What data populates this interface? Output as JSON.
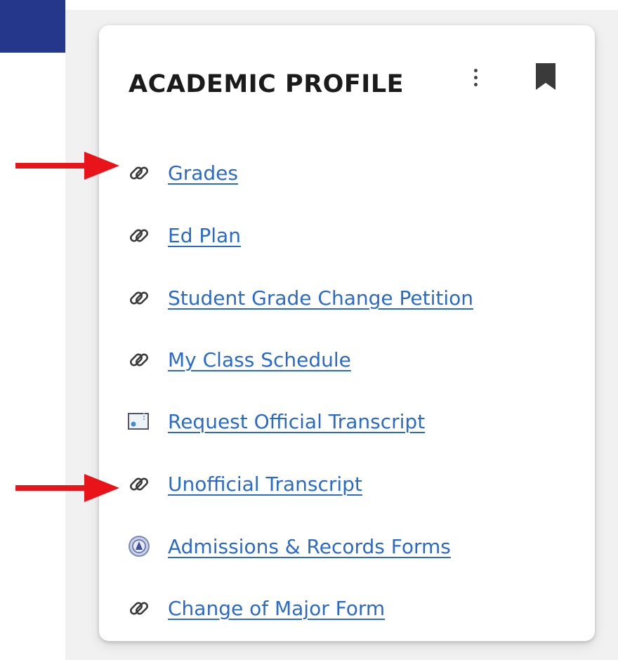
{
  "card": {
    "title": "ACADEMIC PROFILE",
    "more_icon": "more-vertical-icon",
    "bookmark_icon": "bookmark-icon"
  },
  "links": [
    {
      "label": "Grades",
      "icon": "link-icon"
    },
    {
      "label": "Ed Plan",
      "icon": "link-icon"
    },
    {
      "label": "Student Grade Change Petition",
      "icon": "link-icon"
    },
    {
      "label": "My Class Schedule",
      "icon": "link-icon"
    },
    {
      "label": "Request Official Transcript",
      "icon": "document-image-icon"
    },
    {
      "label": "Unofficial Transcript",
      "icon": "link-icon"
    },
    {
      "label": "Admissions & Records Forms",
      "icon": "college-seal-icon"
    },
    {
      "label": "Change of Major Form",
      "icon": "link-icon"
    }
  ],
  "annotations": {
    "arrow_color": "#e8141a",
    "arrow_targets": [
      "Grades",
      "Unofficial Transcript"
    ]
  },
  "colors": {
    "banner": "#24378a",
    "link": "#2a6acd",
    "title": "#1b1b1b",
    "background": "#f1f1f1"
  }
}
